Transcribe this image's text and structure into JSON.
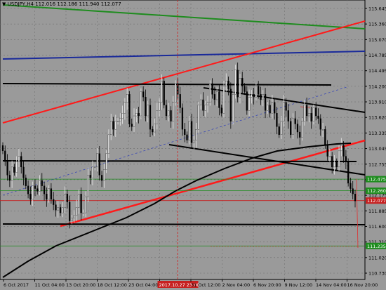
{
  "window": {
    "title_symbol": "USDJPY,H4",
    "ohlc": [
      "112.016",
      "112.186",
      "111.940",
      "112.077"
    ]
  },
  "price_axis": {
    "ticks": [
      "115.645",
      "115.360",
      "115.070",
      "114.785",
      "114.495",
      "114.200",
      "113.910",
      "113.620",
      "113.335",
      "113.045",
      "112.755",
      "112.465",
      "112.175",
      "111.885",
      "111.600",
      "111.310",
      "111.020",
      "110.730"
    ],
    "line_labels": [
      "112.475",
      "112.260",
      "112.077",
      "111.235"
    ],
    "line_label_colors": [
      "#1e8c1e",
      "#1e8c1e",
      "#c62020",
      "#1e8c1e"
    ]
  },
  "time_axis": {
    "ticks": [
      "6 Oct 2017",
      "11 Oct 04:00",
      "13 Oct 20:00",
      "18 Oct 12:00",
      "23 Oct 04:00",
      "2017.10.27 23:00",
      "31 Oct 12:00",
      "2 Nov 04:00",
      "6 Nov 20:00",
      "9 Nov 12:00",
      "14 Nov 04:00",
      "16 Nov 20:00"
    ],
    "crosshair_label": "2017.10.27 23:00",
    "crosshair_label_color": "#c62020"
  },
  "colors": {
    "background": "#9a9a9a",
    "grid": "#6f6f6f",
    "bull_candle": "#e8e8e8",
    "bear_candle": "#000000",
    "red_channel": "#ff1a1a",
    "green_line": "#1e8c1e",
    "blue_line": "#1a2a9a",
    "black_line": "#000000"
  },
  "chart_data": {
    "type": "candlestick",
    "symbol": "USDJPY",
    "timeframe": "H4",
    "ylim": [
      110.73,
      115.645
    ],
    "closes": [
      113.0,
      112.8,
      112.55,
      112.45,
      112.7,
      112.6,
      112.8,
      112.9,
      112.7,
      112.5,
      112.35,
      112.2,
      112.1,
      112.35,
      112.3,
      112.25,
      112.45,
      112.35,
      112.2,
      112.1,
      112.3,
      112.1,
      112.0,
      111.9,
      111.95,
      111.85,
      111.95,
      112.2,
      112.05,
      111.7,
      111.75,
      111.8,
      111.95,
      112.2,
      111.85,
      111.85,
      112.15,
      112.55,
      112.5,
      112.7,
      112.7,
      112.95,
      112.55,
      112.45,
      112.65,
      112.95,
      113.3,
      113.55,
      113.4,
      113.55,
      113.55,
      113.6,
      113.7,
      113.9,
      114.05,
      113.5,
      113.45,
      113.65,
      113.7,
      113.65,
      114.1,
      114.0,
      113.65,
      113.85,
      113.4,
      113.35,
      113.5,
      113.75,
      113.9,
      114.3,
      113.85,
      113.65,
      113.75,
      113.55,
      113.9,
      114.25,
      114.05,
      113.8,
      113.4,
      113.3,
      113.2,
      113.55,
      113.15,
      113.2,
      113.4,
      113.85,
      113.95,
      113.75,
      113.85,
      113.9,
      114.25,
      114.05,
      113.95,
      114.1,
      113.8,
      113.7,
      114.2,
      114.3,
      114.15,
      113.55,
      114.05,
      114.5,
      114.0,
      114.35,
      114.2,
      114.1,
      113.75,
      114.0,
      114.05,
      114.0,
      114.2,
      114.05,
      113.95,
      114.05,
      113.75,
      113.85,
      113.7,
      113.9,
      113.7,
      113.45,
      113.3,
      113.55,
      113.9,
      113.75,
      113.55,
      113.3,
      113.6,
      113.5,
      113.35,
      113.25,
      113.55,
      113.85,
      113.65,
      113.7,
      113.55,
      113.8,
      113.65,
      113.6,
      113.4,
      113.4,
      113.1,
      112.9,
      112.9,
      112.7,
      112.8,
      112.7,
      113.0,
      113.1,
      112.9,
      112.8,
      112.4,
      112.3,
      112.2,
      112.07
    ],
    "price_lines": [
      112.475,
      112.26,
      112.077,
      111.235
    ],
    "vertical_line_time": "2017.10.27 23:00"
  }
}
